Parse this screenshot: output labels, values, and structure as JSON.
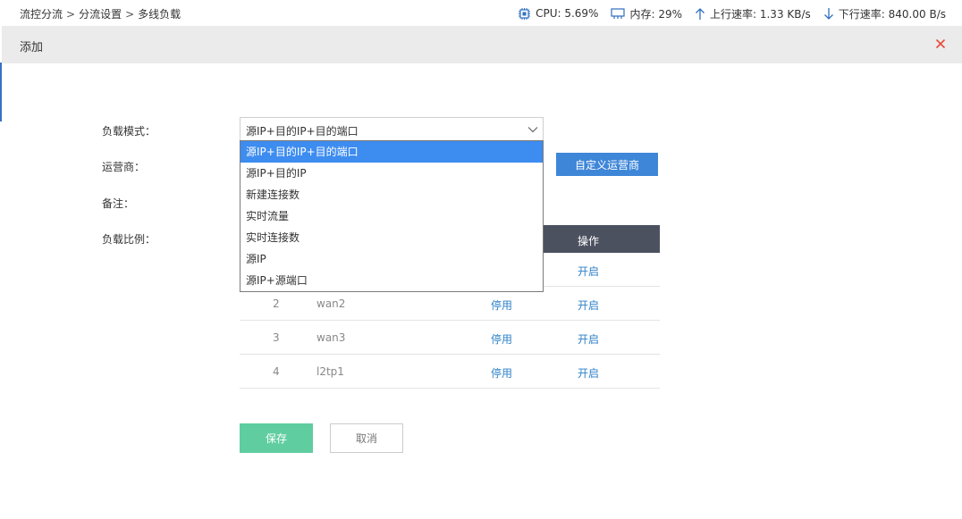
{
  "breadcrumb": [
    "流控分流",
    "分流设置",
    "多线负载"
  ],
  "breadcrumb_sep": ">",
  "stats": {
    "cpu": "CPU: 5.69%",
    "memory": "内存: 29%",
    "upload": "上行速率: 1.33 KB/s",
    "download": "下行速率: 840.00 B/s"
  },
  "modal": {
    "title": "添加",
    "close_icon": "close-icon",
    "close_color": "#e74c3c"
  },
  "form": {
    "load_mode_label": "负载模式：",
    "isp_label": "运营商：",
    "remark_label": "备注：",
    "ratio_label": "负载比例：",
    "load_mode_value": "源IP+目的IP+目的端口",
    "load_mode_options": [
      "源IP+目的IP+目的端口",
      "源IP+目的IP",
      "新建连接数",
      "实时流量",
      "实时连接数",
      "源IP",
      "源IP+源端口"
    ],
    "custom_isp_button": "自定义运营商"
  },
  "table": {
    "op_header": "操作",
    "rows": [
      {
        "no": "",
        "name": "",
        "status": "",
        "op": "开启"
      },
      {
        "no": "2",
        "name": "wan2",
        "status": "停用",
        "op": "开启"
      },
      {
        "no": "3",
        "name": "wan3",
        "status": "停用",
        "op": "开启"
      },
      {
        "no": "4",
        "name": "l2tp1",
        "status": "停用",
        "op": "开启"
      }
    ]
  },
  "buttons": {
    "save": "保存",
    "cancel": "取消"
  },
  "colors": {
    "accent_blue": "#3e86d8",
    "save_green": "#5fcda0",
    "table_header": "#4c5160",
    "selected_option": "#3d8cf0",
    "link_blue": "#2f82c8"
  }
}
